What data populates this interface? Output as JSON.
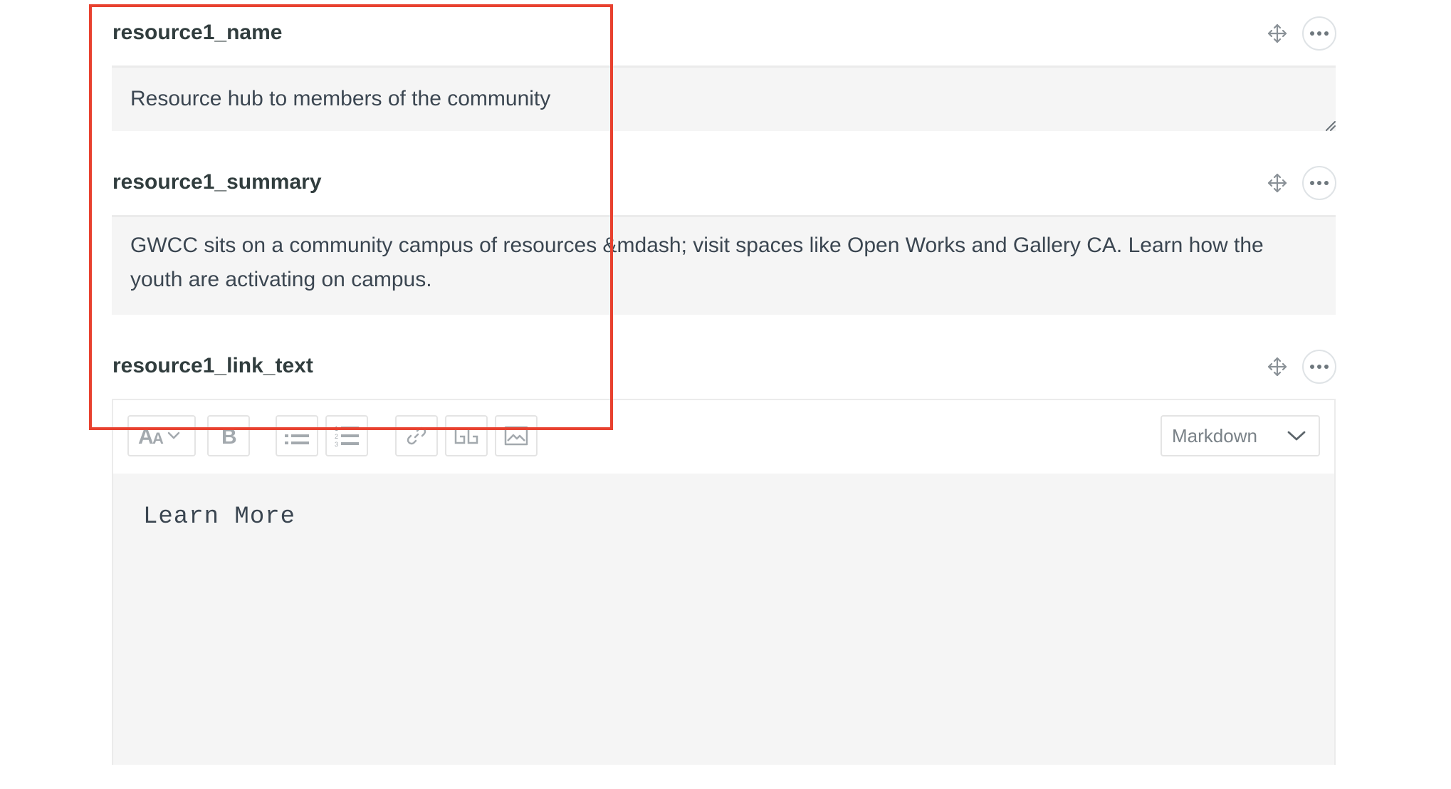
{
  "fields": {
    "name": {
      "label": "resource1_name",
      "value": "Resource hub to members of the community"
    },
    "summary": {
      "label": "resource1_summary",
      "value": "GWCC sits on a community campus of resources &mdash; visit spaces like Open Works and Gallery CA. Learn how the youth are activating on campus."
    },
    "link_text": {
      "label": "resource1_link_text",
      "value": "Learn More",
      "mode": "Markdown"
    }
  },
  "icons": {
    "drag": "move-arrows-icon",
    "more": "ellipsis-icon",
    "heading": "font-size-icon",
    "bold": "bold-icon",
    "bullet_list": "bulleted-list-icon",
    "numbered_list": "numbered-list-icon",
    "link": "link-icon",
    "code_block": "code-block-icon",
    "image": "image-icon",
    "chevron": "chevron-down-icon"
  },
  "colors": {
    "highlight": "#e8412f",
    "input_background": "#f5f5f5",
    "label_text": "#313d3e"
  }
}
